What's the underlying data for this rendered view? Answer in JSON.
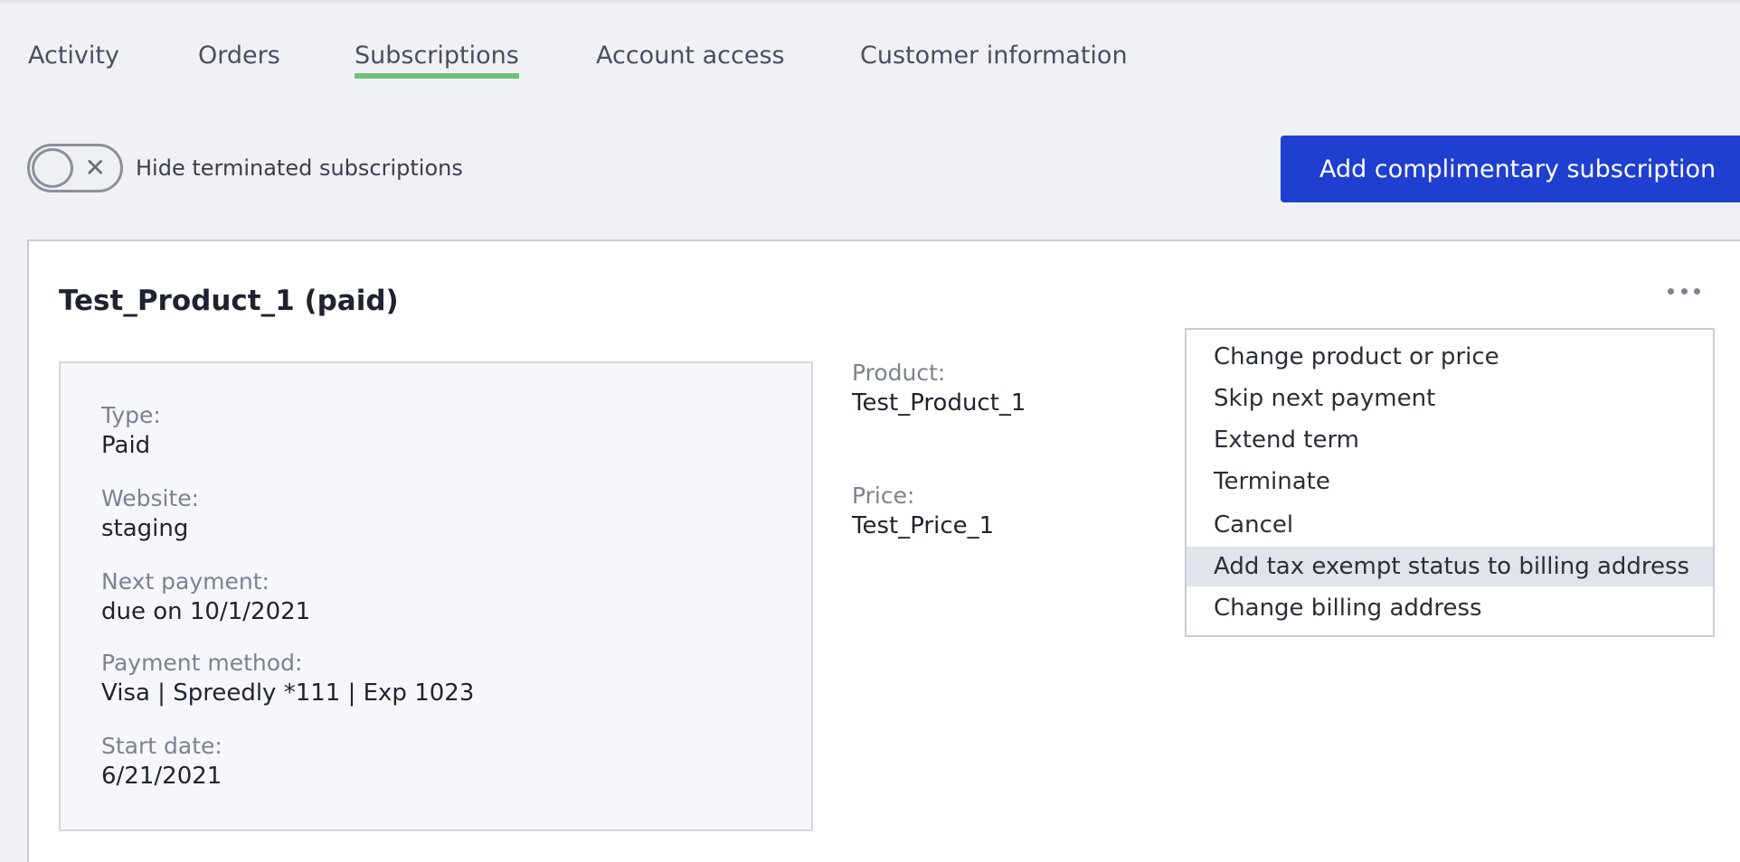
{
  "tabs": [
    {
      "label": "Activity"
    },
    {
      "label": "Orders"
    },
    {
      "label": "Subscriptions"
    },
    {
      "label": "Account access"
    },
    {
      "label": "Customer information"
    }
  ],
  "active_tab": "Subscriptions",
  "filters": {
    "hide_terminated_label": "Hide terminated subscriptions",
    "hide_terminated_on": false
  },
  "actions": {
    "add_complimentary_label": "Add complimentary subscription"
  },
  "subscription": {
    "title": "Test_Product_1 (paid)",
    "details": [
      {
        "label": "Type:",
        "value": "Paid"
      },
      {
        "label": "Website:",
        "value": "staging"
      },
      {
        "label": "Next payment:",
        "value": "due on 10/1/2021"
      },
      {
        "label": "Payment method:",
        "value": "Visa | Spreedly *111 | Exp 1023"
      },
      {
        "label": "Start date:",
        "value": "6/21/2021"
      }
    ],
    "product": {
      "label": "Product:",
      "value": "Test_Product_1"
    },
    "price": {
      "label": "Price:",
      "value": "Test_Price_1"
    }
  },
  "menu": {
    "items": [
      {
        "label": "Change product or price"
      },
      {
        "label": "Skip next payment"
      },
      {
        "label": "Extend term"
      },
      {
        "label": "Terminate"
      },
      {
        "label": "Cancel"
      },
      {
        "label": "Add tax exempt status to billing address"
      },
      {
        "label": "Change billing address"
      }
    ],
    "highlighted_item": "Add tax exempt status to billing address"
  },
  "colors": {
    "accent_button": "#1f3fd1",
    "tab_underline": "#6cc276",
    "background": "#f0f1f5"
  }
}
